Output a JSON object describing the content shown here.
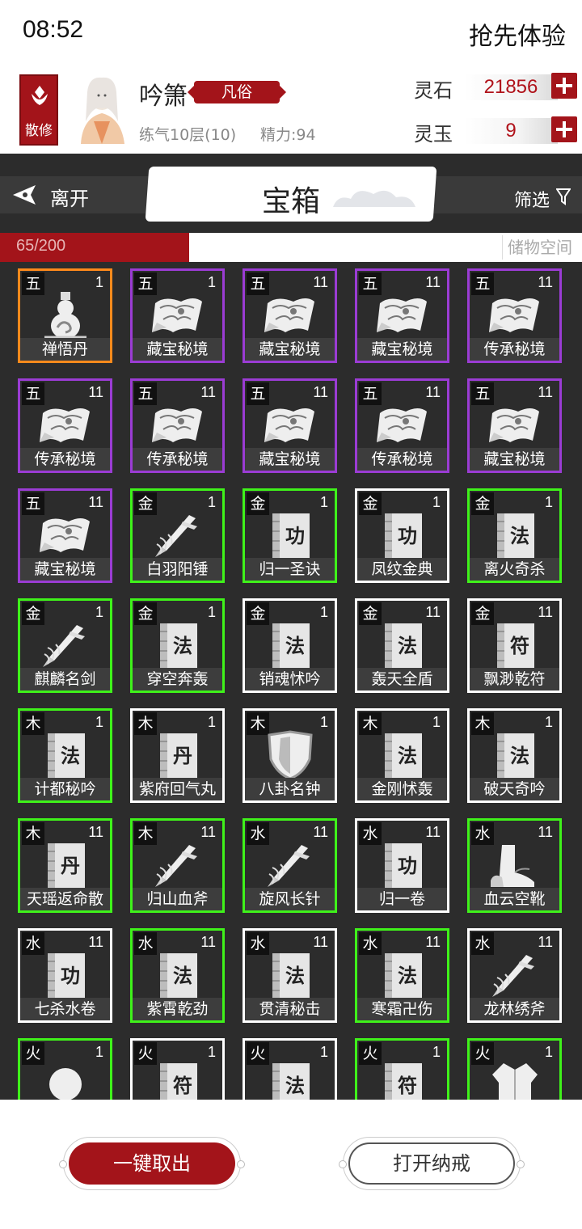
{
  "status": {
    "time": "08:52",
    "right_text": "抢先体验"
  },
  "player": {
    "sect": "散修",
    "name": "吟箫",
    "rank": "凡俗",
    "level": "练气10层(10)",
    "energy": "精力:94"
  },
  "currencies": [
    {
      "name": "灵石",
      "value": "21856"
    },
    {
      "name": "灵玉",
      "value": "9"
    }
  ],
  "toolbar": {
    "leave_label": "离开",
    "title": "宝箱",
    "filter_label": "筛选"
  },
  "capacity": {
    "text": "65/200",
    "used": 65,
    "max": 200,
    "label": "储物空间"
  },
  "colors": {
    "accent": "#a3141a",
    "orange": "#ff8a1c",
    "purple": "#9b3cd4",
    "green": "#3ff21a",
    "white": "#ffffff",
    "dark": "#2c2c2c"
  },
  "items": [
    {
      "el": "五",
      "count": "1",
      "name": "禅悟丹",
      "quality": "orange",
      "icon": "gourd-icon"
    },
    {
      "el": "五",
      "count": "1",
      "name": "藏宝秘境",
      "quality": "purple",
      "icon": "scroll-map-icon"
    },
    {
      "el": "五",
      "count": "11",
      "name": "藏宝秘境",
      "quality": "purple",
      "icon": "scroll-map-icon"
    },
    {
      "el": "五",
      "count": "11",
      "name": "藏宝秘境",
      "quality": "purple",
      "icon": "scroll-map-icon"
    },
    {
      "el": "五",
      "count": "11",
      "name": "传承秘境",
      "quality": "purple",
      "icon": "scroll-map-icon"
    },
    {
      "el": "五",
      "count": "11",
      "name": "传承秘境",
      "quality": "purple",
      "icon": "scroll-map-icon"
    },
    {
      "el": "五",
      "count": "11",
      "name": "传承秘境",
      "quality": "purple",
      "icon": "scroll-map-icon"
    },
    {
      "el": "五",
      "count": "11",
      "name": "藏宝秘境",
      "quality": "purple",
      "icon": "scroll-map-icon"
    },
    {
      "el": "五",
      "count": "11",
      "name": "传承秘境",
      "quality": "purple",
      "icon": "scroll-map-icon"
    },
    {
      "el": "五",
      "count": "11",
      "name": "藏宝秘境",
      "quality": "purple",
      "icon": "scroll-map-icon"
    },
    {
      "el": "五",
      "count": "11",
      "name": "藏宝秘境",
      "quality": "purple",
      "icon": "scroll-map-icon"
    },
    {
      "el": "金",
      "count": "1",
      "name": "白羽阳锤",
      "quality": "green",
      "icon": "sword-icon"
    },
    {
      "el": "金",
      "count": "1",
      "name": "归一圣诀",
      "quality": "green",
      "icon": "book-icon",
      "glyph": "功"
    },
    {
      "el": "金",
      "count": "1",
      "name": "凤纹金典",
      "quality": "white",
      "icon": "book-icon",
      "glyph": "功"
    },
    {
      "el": "金",
      "count": "1",
      "name": "离火奇杀",
      "quality": "green",
      "icon": "book-icon",
      "glyph": "法"
    },
    {
      "el": "金",
      "count": "1",
      "name": "麒麟名剑",
      "quality": "green",
      "icon": "sword-icon"
    },
    {
      "el": "金",
      "count": "1",
      "name": "穿空奔轰",
      "quality": "green",
      "icon": "book-icon",
      "glyph": "法"
    },
    {
      "el": "金",
      "count": "1",
      "name": "销魂怵吟",
      "quality": "white",
      "icon": "book-icon",
      "glyph": "法"
    },
    {
      "el": "金",
      "count": "11",
      "name": "轰天全盾",
      "quality": "white",
      "icon": "book-icon",
      "glyph": "法"
    },
    {
      "el": "金",
      "count": "11",
      "name": "飘渺乾符",
      "quality": "white",
      "icon": "book-icon",
      "glyph": "符"
    },
    {
      "el": "木",
      "count": "1",
      "name": "计都秘吟",
      "quality": "green",
      "icon": "book-icon",
      "glyph": "法"
    },
    {
      "el": "木",
      "count": "1",
      "name": "紫府回气丸",
      "quality": "white",
      "icon": "book-icon",
      "glyph": "丹"
    },
    {
      "el": "木",
      "count": "1",
      "name": "八卦名钟",
      "quality": "white",
      "icon": "shield-icon"
    },
    {
      "el": "木",
      "count": "1",
      "name": "金刚怵轰",
      "quality": "white",
      "icon": "book-icon",
      "glyph": "法"
    },
    {
      "el": "木",
      "count": "1",
      "name": "破天奇吟",
      "quality": "white",
      "icon": "book-icon",
      "glyph": "法"
    },
    {
      "el": "木",
      "count": "11",
      "name": "天瑶返命散",
      "quality": "green",
      "icon": "book-icon",
      "glyph": "丹"
    },
    {
      "el": "木",
      "count": "11",
      "name": "归山血斧",
      "quality": "green",
      "icon": "sword-icon"
    },
    {
      "el": "水",
      "count": "11",
      "name": "旋风长针",
      "quality": "green",
      "icon": "sword-icon"
    },
    {
      "el": "水",
      "count": "11",
      "name": "归一卷",
      "quality": "white",
      "icon": "book-icon",
      "glyph": "功"
    },
    {
      "el": "水",
      "count": "11",
      "name": "血云空靴",
      "quality": "green",
      "icon": "boots-icon"
    },
    {
      "el": "水",
      "count": "11",
      "name": "七杀水卷",
      "quality": "white",
      "icon": "book-icon",
      "glyph": "功"
    },
    {
      "el": "水",
      "count": "11",
      "name": "紫霄乾劲",
      "quality": "green",
      "icon": "book-icon",
      "glyph": "法"
    },
    {
      "el": "水",
      "count": "11",
      "name": "贯清秘击",
      "quality": "white",
      "icon": "book-icon",
      "glyph": "法"
    },
    {
      "el": "水",
      "count": "11",
      "name": "寒霜卍伤",
      "quality": "green",
      "icon": "book-icon",
      "glyph": "法"
    },
    {
      "el": "水",
      "count": "11",
      "name": "龙林绣斧",
      "quality": "white",
      "icon": "sword-icon"
    },
    {
      "el": "火",
      "count": "1",
      "name": "",
      "quality": "green",
      "icon": "orb-icon"
    },
    {
      "el": "火",
      "count": "1",
      "name": "",
      "quality": "white",
      "icon": "book-icon",
      "glyph": "符"
    },
    {
      "el": "火",
      "count": "1",
      "name": "",
      "quality": "white",
      "icon": "book-icon",
      "glyph": "法"
    },
    {
      "el": "火",
      "count": "1",
      "name": "",
      "quality": "green",
      "icon": "book-icon",
      "glyph": "符"
    },
    {
      "el": "火",
      "count": "1",
      "name": "",
      "quality": "green",
      "icon": "robe-icon"
    }
  ],
  "actions": {
    "take_all": "一键取出",
    "open_ring": "打开纳戒"
  }
}
